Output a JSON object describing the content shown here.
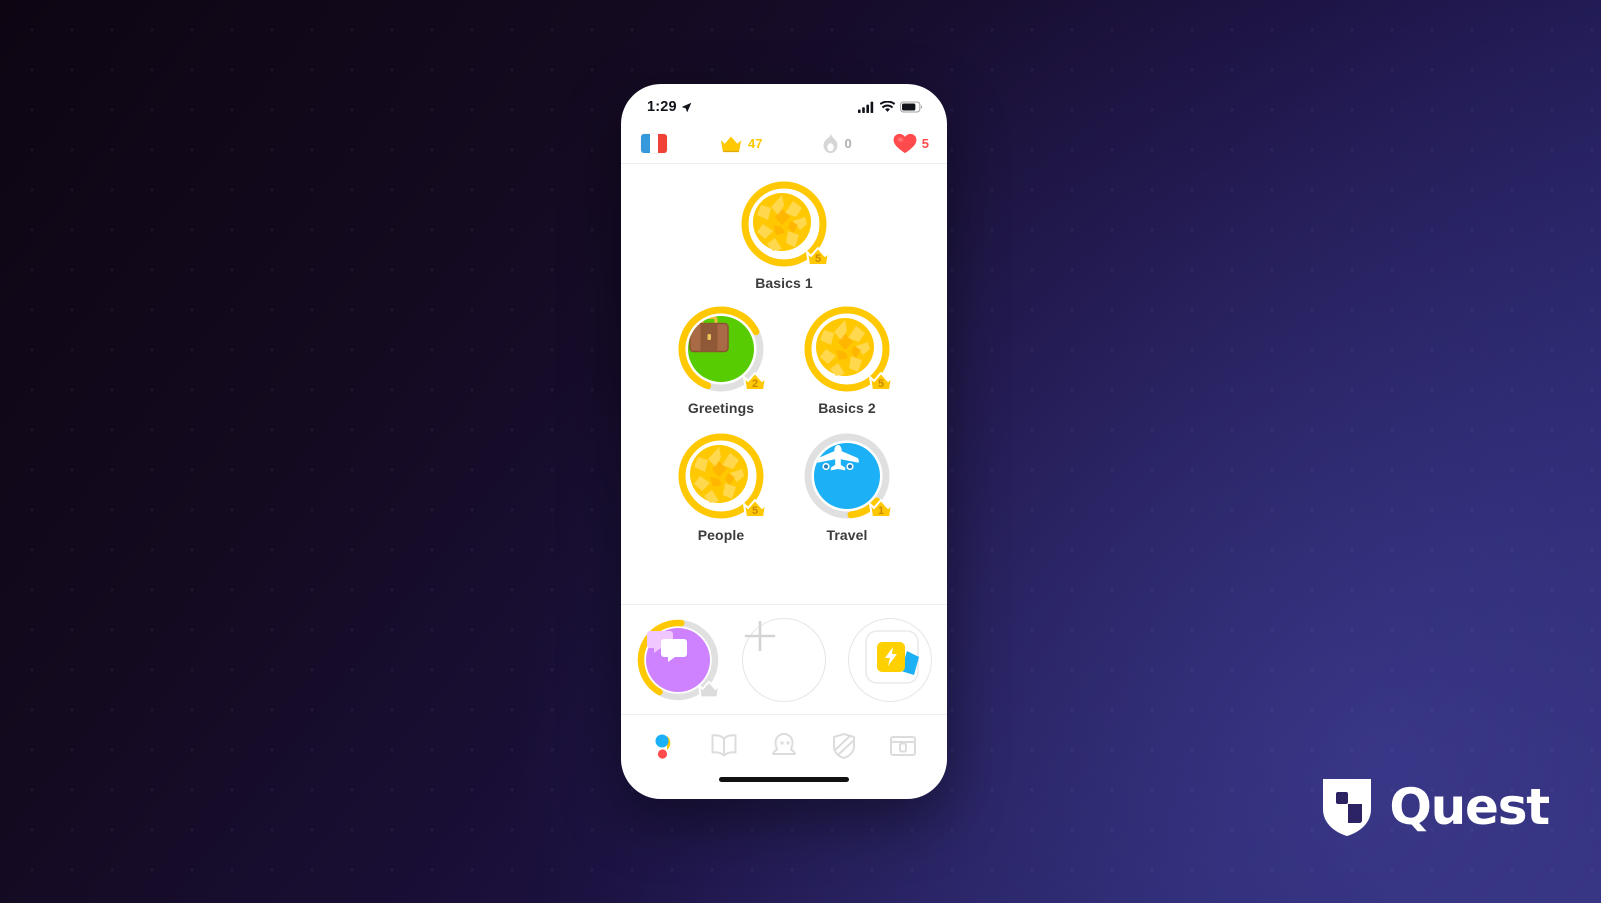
{
  "brand": {
    "name": "Quest",
    "logo_icon": "quest-shield-logo",
    "logo_color": "#ffffff"
  },
  "background": {
    "gradient_from": "#0d0512",
    "gradient_to": "#2e2b72",
    "dot_pattern": true
  },
  "phone": {
    "status_bar": {
      "time": "1:29",
      "location_icon": "location-arrow-icon",
      "signal_icon": "cellular-signal-icon",
      "wifi_icon": "wifi-icon",
      "battery_icon": "battery-icon"
    },
    "header": {
      "flag": {
        "icon": "flag-france-icon",
        "colors": [
          "#3498db",
          "#ffffff",
          "#ef4135"
        ],
        "language": "French"
      },
      "crowns": {
        "icon": "crown-icon",
        "value": "47",
        "color": "#ffc800"
      },
      "streak": {
        "icon": "streak-flame-icon",
        "value": "0",
        "color": "#afafaf"
      },
      "hearts": {
        "icon": "heart-icon",
        "value": "5",
        "color": "#ff4b4b"
      }
    },
    "tree": {
      "rows": [
        {
          "nodes": [
            {
              "label": "Basics 1",
              "icon": "cracked-egg-gold-icon",
              "style": "gold",
              "crown_level": "5",
              "progress": 100,
              "ring_color": "#ffc800",
              "track_color": "#e5e5e5"
            }
          ]
        },
        {
          "nodes": [
            {
              "label": "Greetings",
              "icon": "briefcase-icon",
              "style": "green",
              "crown_level": "2",
              "progress": 62,
              "ring_color": "#ffc800",
              "track_color": "#e0e0e0"
            },
            {
              "label": "Basics 2",
              "icon": "cracked-egg-gold-icon",
              "style": "gold",
              "crown_level": "5",
              "progress": 100,
              "ring_color": "#ffc800",
              "track_color": "#e5e5e5"
            }
          ]
        },
        {
          "nodes": [
            {
              "label": "People",
              "icon": "cracked-egg-gold-icon",
              "style": "gold",
              "crown_level": "5",
              "progress": 100,
              "ring_color": "#ffc800",
              "track_color": "#e5e5e5"
            },
            {
              "label": "Travel",
              "icon": "airplane-icon",
              "style": "blue",
              "crown_level": "1",
              "progress": 12,
              "ring_color": "#ffc800",
              "track_color": "#e0e0e0"
            }
          ]
        }
      ]
    },
    "actions": [
      {
        "name": "conversation-practice",
        "icon": "speech-bubbles-icon",
        "style": "purple",
        "fill_color": "#ce82ff",
        "crown_level": "",
        "progress": 40,
        "ring_color": "#ffc800",
        "track_color": "#e0e0e0"
      },
      {
        "name": "add-skill",
        "icon": "plus-icon",
        "style": "outline"
      },
      {
        "name": "flashcards",
        "icon": "flashcards-lightning-icon",
        "style": "outline"
      }
    ],
    "nav": [
      {
        "name": "learn",
        "icon": "learn-dots-icon",
        "active": true
      },
      {
        "name": "stories",
        "icon": "book-icon",
        "active": false
      },
      {
        "name": "profile",
        "icon": "character-icon",
        "active": false
      },
      {
        "name": "leagues",
        "icon": "shield-icon",
        "active": false
      },
      {
        "name": "chests",
        "icon": "treasure-chest-icon",
        "active": false
      }
    ]
  }
}
